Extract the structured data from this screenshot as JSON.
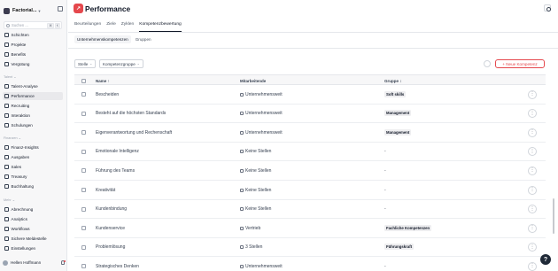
{
  "sidebar": {
    "company": "Factorial...",
    "search_placeholder": "Suchen ...",
    "shortcut_keys": [
      "⌘",
      "K"
    ],
    "items_top": [
      {
        "label": "Schichten",
        "icon": "calendar-icon"
      },
      {
        "label": "Projekte",
        "icon": "folder-icon"
      },
      {
        "label": "Benefits",
        "icon": "gift-icon"
      },
      {
        "label": "Vergütung",
        "icon": "money-icon"
      }
    ],
    "sections": [
      {
        "title": "Talent",
        "items": [
          {
            "label": "Talent-Analyse",
            "icon": "chart-icon"
          },
          {
            "label": "Performance",
            "icon": "performance-icon",
            "active": true
          },
          {
            "label": "Recruiting",
            "icon": "user-search-icon"
          },
          {
            "label": "Interaktion",
            "icon": "chat-icon"
          },
          {
            "label": "Schulungen",
            "icon": "graduation-icon"
          }
        ]
      },
      {
        "title": "Finanzen",
        "items": [
          {
            "label": "Finanz-Insights",
            "icon": "insights-icon"
          },
          {
            "label": "Ausgaben",
            "icon": "receipt-icon"
          },
          {
            "label": "Sales",
            "icon": "sales-icon"
          },
          {
            "label": "Treasury",
            "icon": "bank-icon"
          },
          {
            "label": "Buchhaltung",
            "icon": "ledger-icon"
          }
        ]
      },
      {
        "title": "Mehr",
        "items": [
          {
            "label": "Abrechnung",
            "icon": "payroll-icon"
          },
          {
            "label": "Analytics",
            "icon": "analytics-icon"
          },
          {
            "label": "Workflows",
            "icon": "workflow-icon"
          },
          {
            "label": "Sichere Meldestelle",
            "icon": "shield-icon"
          },
          {
            "label": "Einstellungen",
            "icon": "gear-icon"
          }
        ]
      }
    ],
    "user": "Hellen Hoffmann"
  },
  "header": {
    "title": "Performance",
    "tabs": [
      "Beurteilungen",
      "Ziele",
      "Zyklen",
      "Kompetenzbewertung"
    ],
    "active_tab": "Kompetenzbewertung",
    "subtabs": [
      "Unternehmenskompetenzen",
      "Gruppen"
    ],
    "active_subtab": "Unternehmenskompetenzen"
  },
  "toolbar": {
    "filters": [
      "Stelle",
      "Kompetenzgruppe"
    ],
    "new_button": "+ Neue Kompetenz"
  },
  "table": {
    "columns": [
      "Name",
      "Mitarbeitende",
      "Gruppe"
    ],
    "sort_indicator": "↑",
    "rows": [
      {
        "name": "Bescheiden",
        "employees": "Unternehmensweit",
        "group": "Soft skills"
      },
      {
        "name": "Besteht auf die höchsten Standards",
        "employees": "Unternehmensweit",
        "group": "Management"
      },
      {
        "name": "Eigenverantwortung und Rechenschaft",
        "employees": "Unternehmensweit",
        "group": "Management"
      },
      {
        "name": "Emotionale Intelligenz",
        "employees": "Keine Stellen",
        "group": "-"
      },
      {
        "name": "Führung des Teams",
        "employees": "Keine Stellen",
        "group": "-"
      },
      {
        "name": "Kreativität",
        "employees": "Keine Stellen",
        "group": "-"
      },
      {
        "name": "Kundenbindung",
        "employees": "Keine Stellen",
        "group": "-"
      },
      {
        "name": "Kundenservice",
        "employees": "Vertrieb",
        "group": "Fachliche Kompetenzen"
      },
      {
        "name": "Problemlösung",
        "employees": "3 Stellen",
        "group": "Führungskraft"
      },
      {
        "name": "Strategisches Denken",
        "employees": "Unternehmensweit",
        "group": "-"
      }
    ],
    "row_menu": "⋮"
  },
  "help": "?"
}
